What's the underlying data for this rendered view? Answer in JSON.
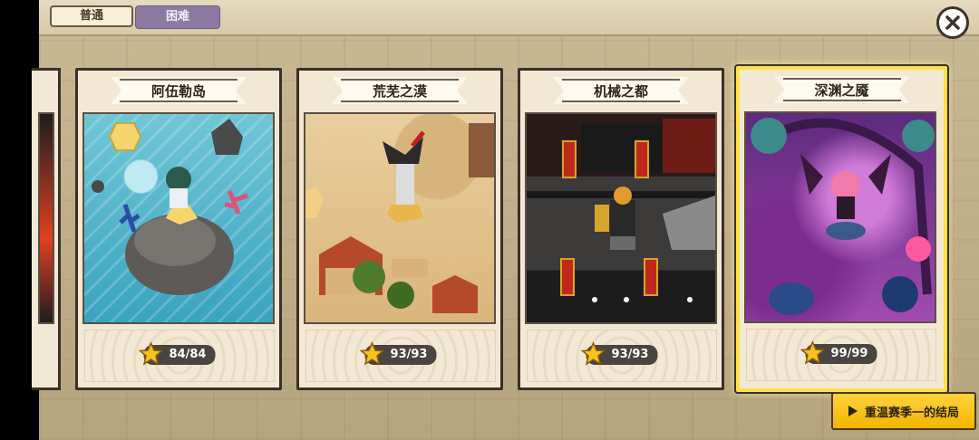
{
  "mode_tabs": [
    {
      "label": "普通",
      "active": true
    },
    {
      "label": "困难",
      "active": false
    }
  ],
  "cards": [
    {
      "title": "阿伍勒岛",
      "score": "84/84",
      "scene": "sea",
      "selected": false
    },
    {
      "title": "荒芜之漠",
      "score": "93/93",
      "scene": "desert",
      "selected": false
    },
    {
      "title": "机械之都",
      "score": "93/93",
      "scene": "machine",
      "selected": false
    },
    {
      "title": "深渊之魇",
      "score": "99/99",
      "scene": "abyss",
      "selected": true
    }
  ],
  "replay_button": {
    "label": "重温赛季一的结局",
    "icon": "play-icon"
  },
  "close_button": {
    "icon": "close-icon"
  },
  "colors": {
    "accent_yellow": "#f2b500",
    "tab_inactive": "#8c7aa2",
    "selected_border": "#ffe04a"
  }
}
